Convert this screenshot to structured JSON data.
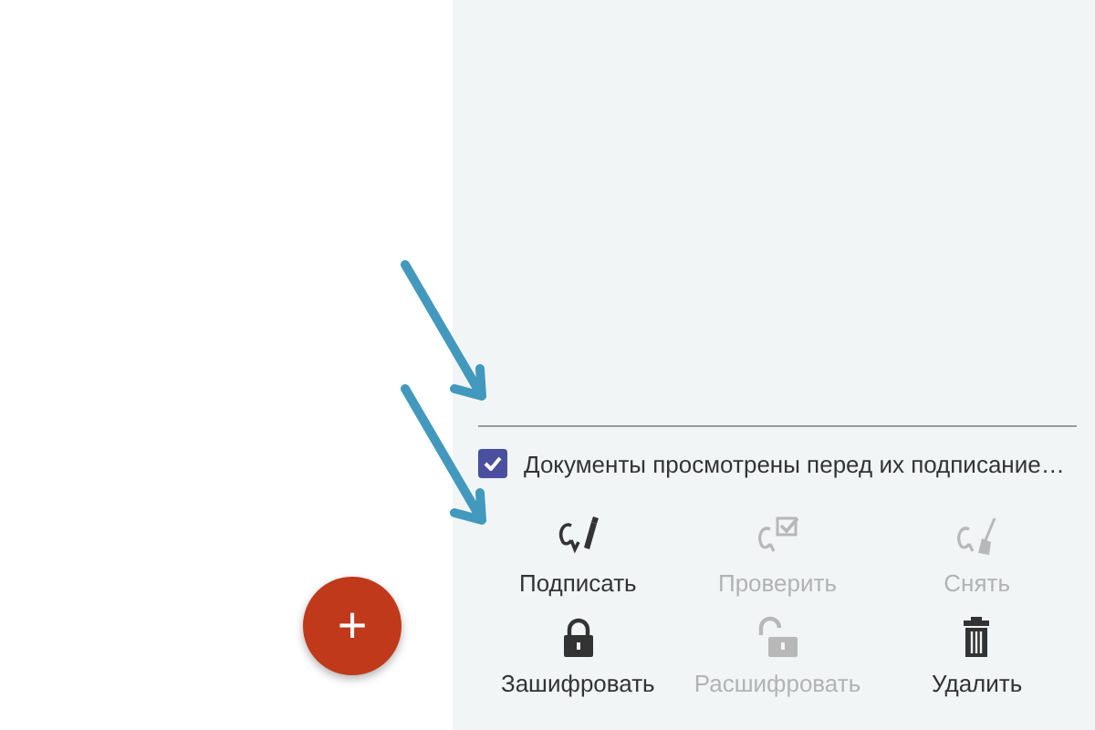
{
  "consent": {
    "label": "Документы просмотрены перед их подписание…",
    "checked": true
  },
  "actions": [
    {
      "label": "Подписать",
      "kind": "sign",
      "disabled": false
    },
    {
      "label": "Проверить",
      "kind": "verify",
      "disabled": true
    },
    {
      "label": "Снять",
      "kind": "unsign",
      "disabled": true
    },
    {
      "label": "Зашифровать",
      "kind": "lock",
      "disabled": false
    },
    {
      "label": "Расшифровать",
      "kind": "unlock",
      "disabled": true
    },
    {
      "label": "Удалить",
      "kind": "trash",
      "disabled": false
    }
  ],
  "fab": {
    "label": "+"
  },
  "annotations": [
    {
      "kind": "arrow"
    },
    {
      "kind": "arrow"
    }
  ]
}
